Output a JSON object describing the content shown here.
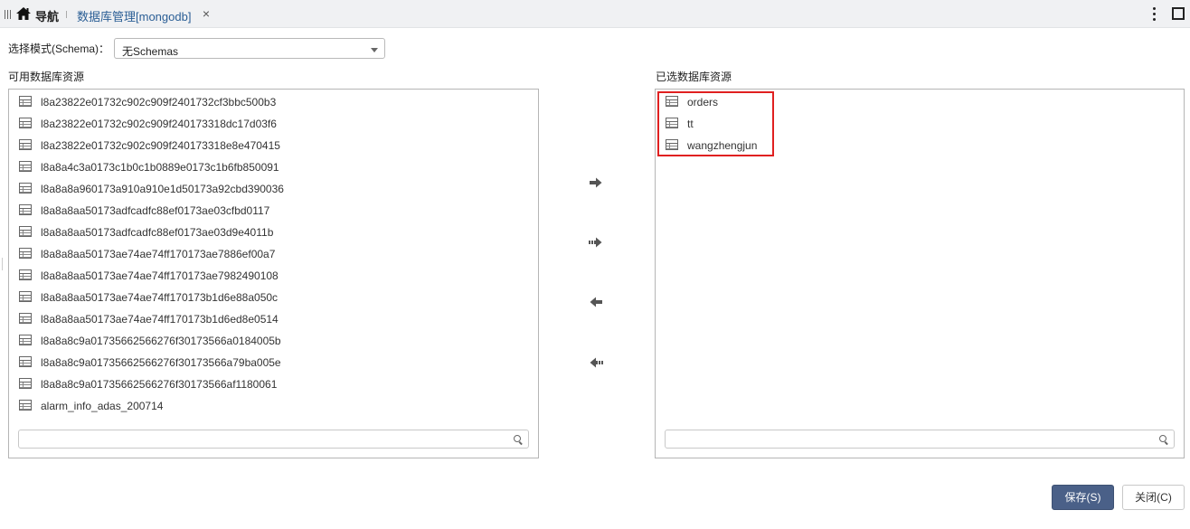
{
  "header": {
    "nav_label": "导航",
    "tab_label": "数据库管理[mongodb]",
    "tab_close": "×",
    "icons": [
      "grip-icon",
      "home-icon",
      "close-icon",
      "more-vertical-icon",
      "maximize-icon"
    ]
  },
  "schema": {
    "label": "选择模式(Schema)：",
    "selected": "无Schemas"
  },
  "available": {
    "title": "可用数据库资源",
    "items": [
      "l8a23822e01732c902c909f2401732cf3bbc500b3",
      "l8a23822e01732c902c909f240173318dc17d03f6",
      "l8a23822e01732c902c909f240173318e8e470415",
      "l8a8a4c3a0173c1b0c1b0889e0173c1b6fb850091",
      "l8a8a8a960173a910a910e1d50173a92cbd390036",
      "l8a8a8aa50173adfcadfc88ef0173ae03cfbd0117",
      "l8a8a8aa50173adfcadfc88ef0173ae03d9e4011b",
      "l8a8a8aa50173ae74ae74ff170173ae7886ef00a7",
      "l8a8a8aa50173ae74ae74ff170173ae7982490108",
      "l8a8a8aa50173ae74ae74ff170173b1d6e88a050c",
      "l8a8a8aa50173ae74ae74ff170173b1d6ed8e0514",
      "l8a8a8c9a01735662566276f30173566a0184005b",
      "l8a8a8c9a01735662566276f30173566a79ba005e",
      "l8a8a8c9a01735662566276f30173566af1180061",
      "alarm_info_adas_200714"
    ],
    "search_value": ""
  },
  "selected": {
    "title": "已选数据库资源",
    "items": [
      "orders",
      "tt",
      "wangzhengjun"
    ],
    "search_value": ""
  },
  "transfer_buttons": [
    "move-right-icon",
    "move-all-right-icon",
    "move-left-icon",
    "move-all-left-icon"
  ],
  "footer": {
    "save_label": "保存(S)",
    "close_label": "关闭(C)"
  },
  "colors": {
    "save_bg": "#4a6088",
    "tab_text": "#2a5e95",
    "highlight": "#e02020"
  }
}
